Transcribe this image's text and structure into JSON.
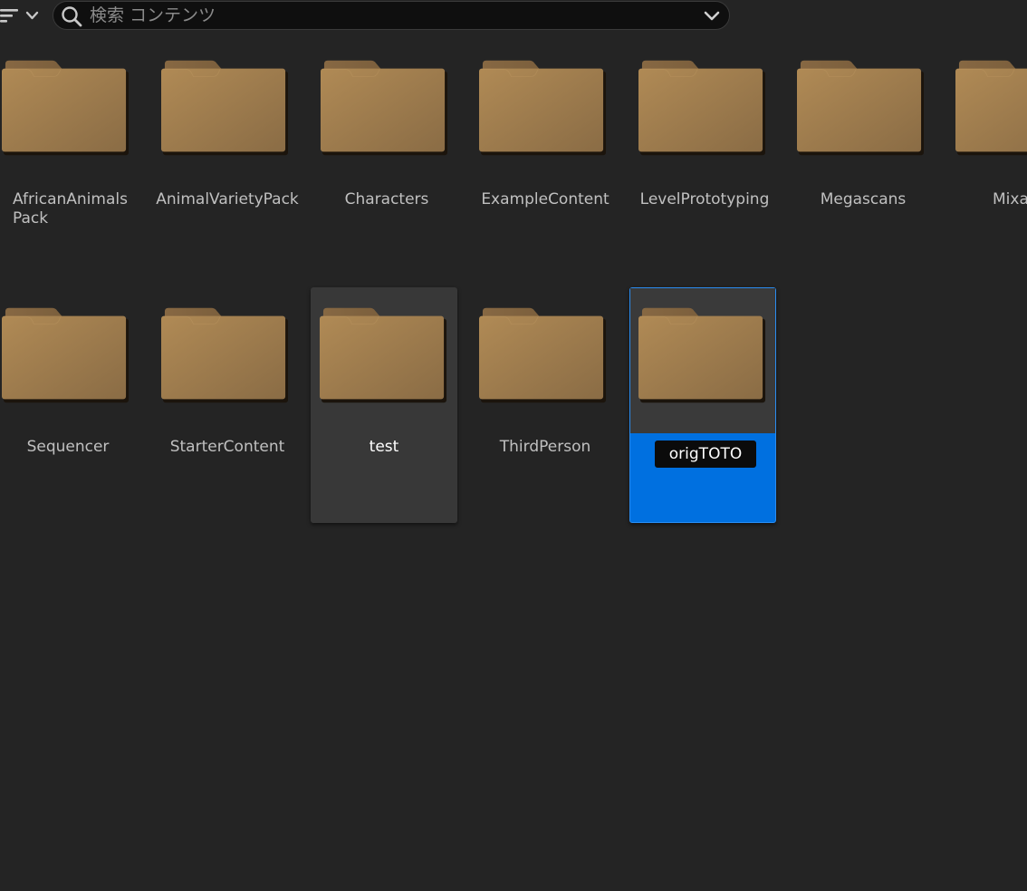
{
  "search": {
    "placeholder": "検索 コンテンツ",
    "value": ""
  },
  "icons": {
    "filter": "filter-icon",
    "filter_dropdown": "chevron-down-icon",
    "search": "search-icon",
    "search_options": "chevron-down-icon",
    "folder": "folder-icon"
  },
  "colors": {
    "background": "#242424",
    "folder": "#a57f4d",
    "selection": "#0070e0",
    "hover": "#383838"
  },
  "folders": [
    {
      "label": "AfricanAnimalsPack",
      "state": "normal"
    },
    {
      "label": "AnimalVarietyPack",
      "state": "normal"
    },
    {
      "label": "Characters",
      "state": "normal"
    },
    {
      "label": "ExampleContent",
      "state": "normal"
    },
    {
      "label": "LevelPrototyping",
      "state": "normal"
    },
    {
      "label": "Megascans",
      "state": "normal"
    },
    {
      "label": "Mixa",
      "state": "clipped"
    },
    {
      "label": "Sequencer",
      "state": "normal"
    },
    {
      "label": "StarterContent",
      "state": "normal"
    },
    {
      "label": "test",
      "state": "hovered"
    },
    {
      "label": "ThirdPerson",
      "state": "normal"
    },
    {
      "label": "origTOTO",
      "state": "selected-renaming"
    }
  ]
}
